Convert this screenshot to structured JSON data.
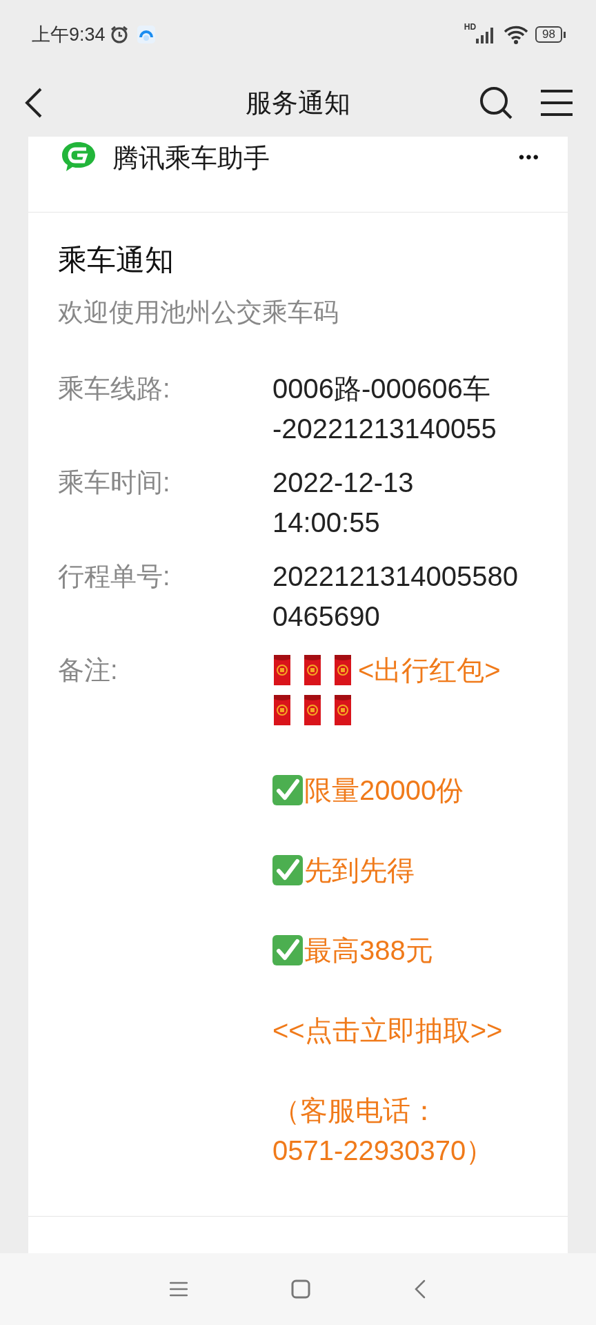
{
  "status_bar": {
    "time": "上午9:34",
    "network": "HD",
    "battery": "98"
  },
  "header": {
    "title": "服务通知"
  },
  "app": {
    "name": "腾讯乘车助手",
    "more": "•••"
  },
  "notice": {
    "title": "乘车通知",
    "subtitle": "欢迎使用池州公交乘车码",
    "rows": [
      {
        "label": "乘车线路:",
        "lines": [
          "0006路-000606车",
          "-20221213140055"
        ]
      },
      {
        "label": "乘车时间:",
        "lines": [
          "2022-12-13",
          "14:00:55"
        ]
      },
      {
        "label": "行程单号:",
        "lines": [
          "2022121314005580",
          "0465690"
        ]
      }
    ],
    "remark": {
      "label": "备注:",
      "paragraphs": [
        {
          "lines": [
            [
              {
                "kind": "envelope"
              },
              {
                "kind": "envelope"
              },
              {
                "kind": "envelope"
              },
              {
                "kind": "text",
                "text": "<出行红包>"
              }
            ],
            [
              {
                "kind": "envelope"
              },
              {
                "kind": "envelope"
              },
              {
                "kind": "envelope"
              }
            ]
          ]
        },
        {
          "lines": [
            [
              {
                "kind": "check"
              },
              {
                "kind": "text",
                "text": "限量20000份"
              }
            ]
          ]
        },
        {
          "lines": [
            [
              {
                "kind": "check"
              },
              {
                "kind": "text",
                "text": "先到先得"
              }
            ]
          ]
        },
        {
          "lines": [
            [
              {
                "kind": "check"
              },
              {
                "kind": "text",
                "text": "最高388元"
              }
            ]
          ]
        },
        {
          "lines": [
            [
              {
                "kind": "text",
                "text": "<<点击立即抽取>>"
              }
            ]
          ]
        },
        {
          "lines": [
            [
              {
                "kind": "text",
                "text": "（客服电话："
              }
            ],
            [
              {
                "kind": "text",
                "text": "0571-22930370）"
              }
            ]
          ]
        }
      ]
    }
  }
}
